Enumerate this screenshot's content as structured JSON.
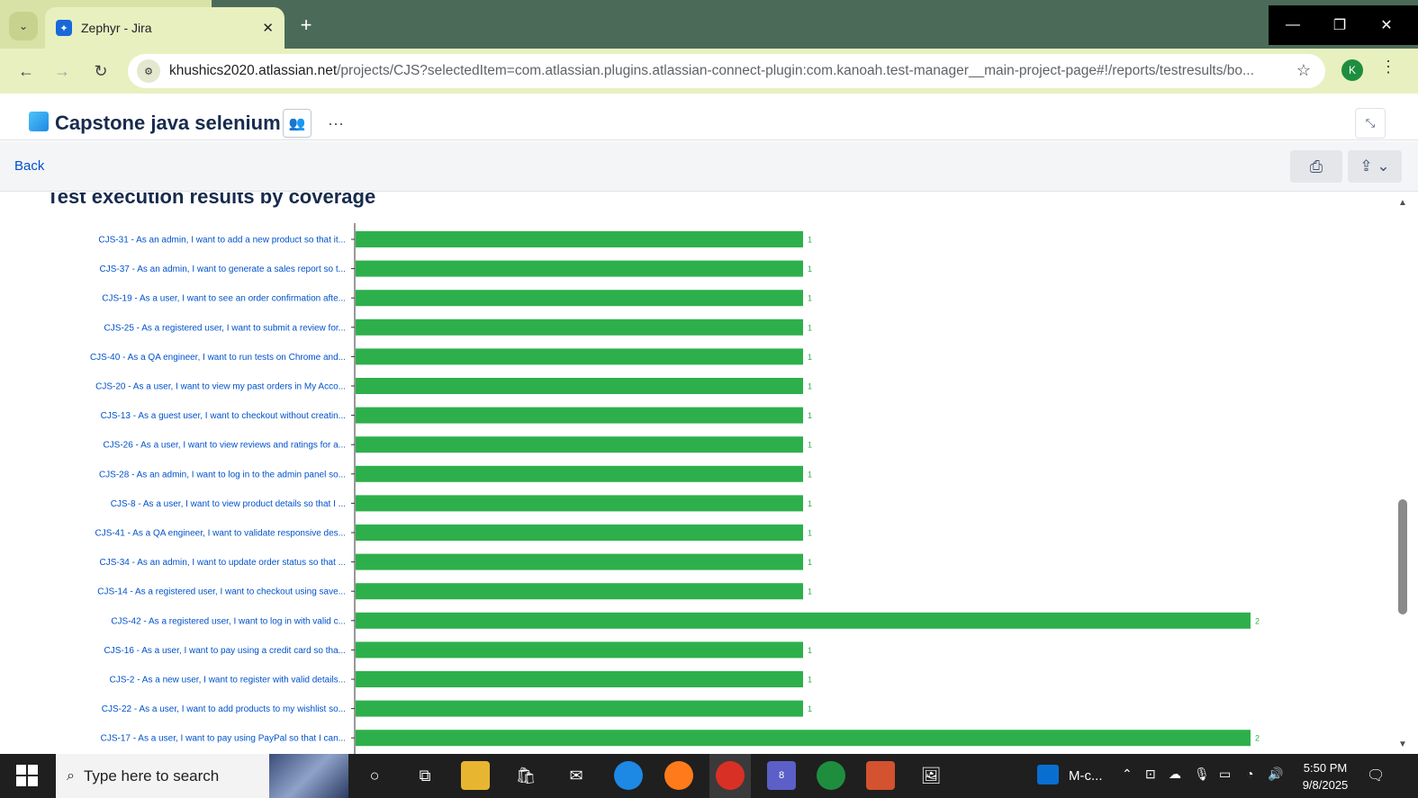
{
  "browser": {
    "tab_title": "Zephyr - Jira",
    "tab_close": "✕",
    "new_tab": "+",
    "url_domain": "khushics2020.atlassian.net",
    "url_path": "/projects/CJS?selectedItem=com.atlassian.plugins.atlassian-connect-plugin:com.kanoah.test-manager__main-project-page#!/reports/testresults/bo...",
    "profile_initial": "K"
  },
  "jira": {
    "project_name": "Capstone java selenium",
    "back_label": "Back"
  },
  "report": {
    "title": "Test execution results by coverage"
  },
  "chart_data": {
    "type": "bar",
    "orientation": "horizontal",
    "bar_color": "#2db04b",
    "categories": [
      "CJS-31 - As an admin, I want to add a new product so that it...",
      "CJS-37 - As an admin, I want to generate a sales report so t...",
      "CJS-19 - As a user, I want to see an order confirmation afte...",
      "CJS-25 - As a registered user, I want to submit a review for...",
      "CJS-40 - As a QA engineer, I want to run tests on Chrome and...",
      "CJS-20 - As a user, I want to view my past orders in My Acco...",
      "CJS-13 - As a guest user, I want to checkout without creatin...",
      "CJS-26 - As a user, I want to view reviews and ratings for a...",
      "CJS-28 - As an admin, I want to log in to the admin panel so...",
      "CJS-8 - As a user, I want to view product details so that I ...",
      "CJS-41 - As a QA engineer, I want to validate responsive des...",
      "CJS-34 - As an admin, I want to update order status so that ...",
      "CJS-14 - As a registered user, I want to checkout using save...",
      "CJS-42 - As a registered user, I want to log in with valid c...",
      "CJS-16 - As a user, I want to pay using a credit card so tha...",
      "CJS-2 - As a new user, I want to register with valid details...",
      "CJS-22 - As a user, I want to add products to my wishlist so...",
      "CJS-17 - As a user, I want to pay using PayPal so that I can..."
    ],
    "values": [
      1,
      1,
      1,
      1,
      1,
      1,
      1,
      1,
      1,
      1,
      1,
      1,
      1,
      2,
      1,
      1,
      1,
      2
    ],
    "xlim": [
      0,
      2
    ],
    "grid": false,
    "legend": "none"
  },
  "taskbar": {
    "search_placeholder": "Type here to search",
    "tray_app_label": "M-c...",
    "teams_badge": "8",
    "time": "5:50 PM",
    "date": "9/8/2025"
  },
  "icons": {
    "tab_search": "chevron-down-icon",
    "back": "arrow-left-icon",
    "forward": "arrow-right-icon",
    "reload": "reload-icon",
    "bookmark": "star-icon",
    "team": "people-icon",
    "print": "printer-icon",
    "export": "share-icon"
  }
}
